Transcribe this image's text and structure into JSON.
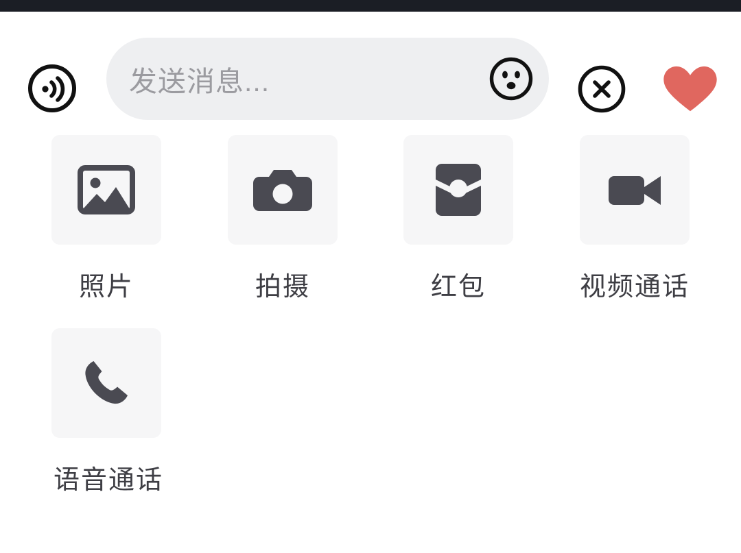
{
  "theme": {
    "background": "#ffffff",
    "status_bar_color": "#1b1e25",
    "pill_background": "#eeeff1",
    "tile_background": "#f6f6f7",
    "icon_color": "#4a4a52",
    "label_color": "#3e3e44",
    "placeholder_color": "#9b9ba0",
    "heart_color": "#e0675f",
    "outline_icon_color": "#111111"
  },
  "input_bar": {
    "voice_button": {
      "name": "voice-message-button",
      "icon": "voice-wave-circle-icon"
    },
    "message_field": {
      "name": "message-input",
      "value": "",
      "placeholder": "发送消息..."
    },
    "emoji_button": {
      "name": "emoji-button",
      "icon": "smiley-face-icon"
    },
    "close_button": {
      "name": "close-panel-button",
      "icon": "close-circle-icon"
    },
    "like_button": {
      "name": "heart-button",
      "icon": "heart-icon"
    }
  },
  "action_panel": {
    "rows": [
      {
        "items": [
          {
            "label": "照片",
            "icon": "photo-image-icon"
          },
          {
            "label": "拍摄",
            "icon": "camera-icon"
          },
          {
            "label": "红包",
            "icon": "red-envelope-icon"
          },
          {
            "label": "视频通话",
            "icon": "video-camera-icon"
          }
        ]
      },
      {
        "items": [
          {
            "label": "语音通话",
            "icon": "phone-handset-icon"
          }
        ]
      }
    ]
  }
}
